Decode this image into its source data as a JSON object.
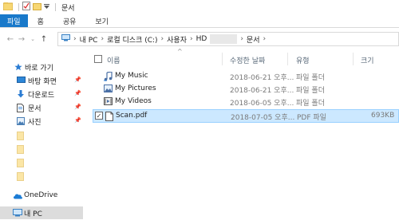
{
  "titlebar": {
    "title": "문서"
  },
  "ribbon": {
    "tabs": [
      "파일",
      "홈",
      "공유",
      "보기"
    ]
  },
  "address": {
    "crumbs": [
      "내 PC",
      "로컬 디스크 (C:)",
      "사용자",
      "HD",
      "문서"
    ]
  },
  "nav": {
    "items": [
      {
        "label": "바로 가기",
        "icon": "star-icon"
      },
      {
        "label": "바탕 화면",
        "icon": "desktop-icon",
        "pinned": true
      },
      {
        "label": "다운로드",
        "icon": "download-arrow-icon",
        "pinned": true
      },
      {
        "label": "문서",
        "icon": "document-icon",
        "pinned": true
      },
      {
        "label": "사진",
        "icon": "pictures-icon",
        "pinned": true
      },
      {
        "label": "OneDrive",
        "icon": "cloud-icon"
      },
      {
        "label": "내 PC",
        "icon": "computer-icon"
      }
    ]
  },
  "list": {
    "columns": [
      "이름",
      "수정한 날짜",
      "유형",
      "크기"
    ],
    "rows": [
      {
        "name": "My Music",
        "modified": "2018-06-21 오후...",
        "type": "파일 폴더",
        "size": "",
        "icon": "music-shortcut-icon"
      },
      {
        "name": "My Pictures",
        "modified": "2018-06-21 오후...",
        "type": "파일 폴더",
        "size": "",
        "icon": "pictures-shortcut-icon"
      },
      {
        "name": "My Videos",
        "modified": "2018-06-05 오후...",
        "type": "파일 폴더",
        "size": "",
        "icon": "videos-shortcut-icon"
      },
      {
        "name": "Scan.pdf",
        "modified": "2018-07-05 오후...",
        "type": "PDF 파일",
        "size": "693KB",
        "icon": "pdf-file-icon"
      }
    ]
  }
}
